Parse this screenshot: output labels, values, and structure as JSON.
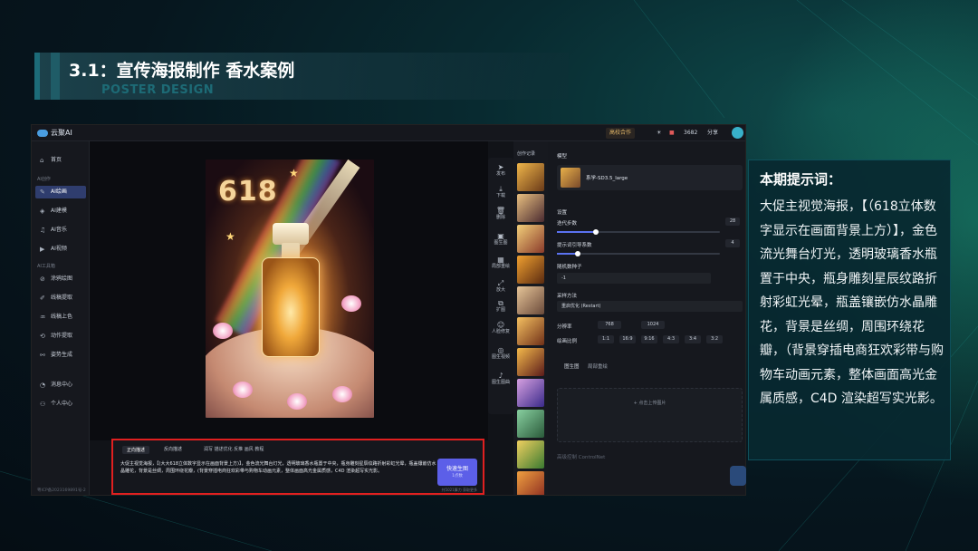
{
  "slide": {
    "title": "3.1：宣传海报制作  香水案例",
    "subtitle": "POSTER DESIGN"
  },
  "app": {
    "logo": "云聚AI",
    "topbar": {
      "cooperate": "高校合作",
      "credits": "3682",
      "share": "分享"
    },
    "sidebar": {
      "home": "首页",
      "section_ai": "AI创作",
      "items": [
        "AI绘画",
        "AI建模",
        "AI音乐",
        "AI视频"
      ],
      "section_tools": "AI工具箱",
      "tools": [
        "涂鸦绘图",
        "线稿提取",
        "线稿上色",
        "动作提取",
        "姿势生成"
      ],
      "message": "消息中心",
      "profile": "个人中心",
      "footer": "粤ICP备2023169891号-2"
    },
    "poster": {
      "number": "618"
    },
    "toolbar": [
      "发布",
      "下载",
      "删除",
      "图生图",
      "局部重绘",
      "放大",
      "扩图",
      "人脸修复",
      "图生视频",
      "图生图曲"
    ],
    "history": {
      "header": "创作记录"
    },
    "params": {
      "model_label": "模型",
      "model_name": "系学-SD3.5_large",
      "settings_label": "设置",
      "steps_label": "迭代步数",
      "steps_value": "28",
      "cfg_label": "提示词引导系数",
      "cfg_value": "4",
      "seed_label": "随机数种子",
      "seed_value": "-1",
      "sampler_label": "采样方法",
      "sampler_value": "重启优化 (Restart)",
      "resolution_label": "分辨率",
      "width": "768",
      "height": "1024",
      "ratio_label": "绘画比例",
      "ratios": [
        "1:1",
        "16:9",
        "9:16",
        "4:3",
        "3:4",
        "3:2"
      ],
      "img2img_tab": "图生图",
      "local_tab": "局部重绘",
      "upload_hint": "+ 点击上传图片",
      "controlnet": "高级控制 ControlNet"
    },
    "prompt_panel": {
      "tab_active": "正向描述",
      "tab_other": "反向描述",
      "tools": "润写  描述优化  反推  画风  教程",
      "text": "大促主视觉海报，【(大大618立体数字显示在画面背景上方)】，金色流光舞台灯光，透明玻璃香水瓶置于中央，瓶身雕刻星辰纹路折射彩虹光晕，瓶盖镶嵌仿水晶雕花，背景是丝绸，周围环绕花瓣，(背景穿插电商狂欢彩带与购物车动画元素，整体画面高光金属质感，C4D 渲染超写实光影。",
      "generate": "快速生图",
      "generate_sub": "1点数",
      "note": "共5021算力 获取更多"
    }
  },
  "tip": {
    "title": "本期提示词：",
    "body": "大促主视觉海报，【（618立体数字显示在画面背景上方）】，金色流光舞台灯光，透明玻璃香水瓶置于中央，瓶身雕刻星辰纹路折射彩虹光晕，瓶盖镶嵌仿水晶雕花，背景是丝绸，周围环绕花瓣，（背景穿插电商狂欢彩带与购物车动画元素，整体画面高光金属质感，C4D 渲染超写实光影。"
  }
}
